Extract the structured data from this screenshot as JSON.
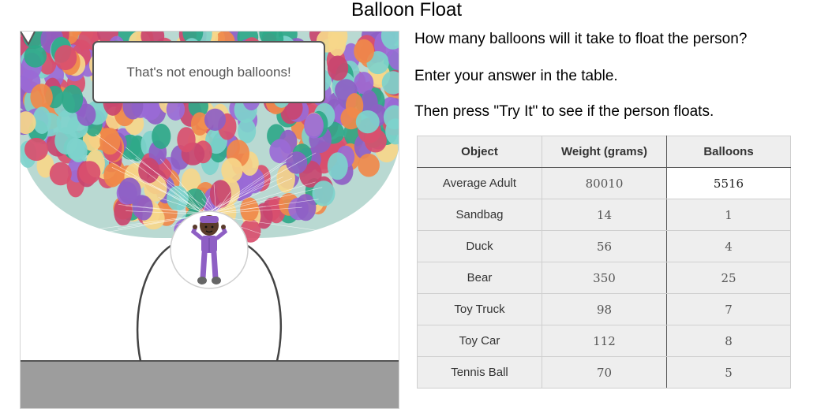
{
  "title": "Balloon Float",
  "speech_bubble": "That's not enough balloons!",
  "instructions": [
    "How many balloons will it take to float the person?",
    "Enter your answer in the table.",
    "Then press \"Try It\" to see if the person floats."
  ],
  "table": {
    "headers": [
      "Object",
      "Weight (grams)",
      "Balloons"
    ],
    "rows": [
      {
        "object": "Average Adult",
        "weight": "80010",
        "balloons": "5516"
      },
      {
        "object": "Sandbag",
        "weight": "14",
        "balloons": "1"
      },
      {
        "object": "Duck",
        "weight": "56",
        "balloons": "4"
      },
      {
        "object": "Bear",
        "weight": "350",
        "balloons": "25"
      },
      {
        "object": "Toy Truck",
        "weight": "98",
        "balloons": "7"
      },
      {
        "object": "Toy Car",
        "weight": "112",
        "balloons": "8"
      },
      {
        "object": "Tennis Ball",
        "weight": "70",
        "balloons": "5"
      }
    ]
  },
  "colors": {
    "balloons": [
      "#d94f6e",
      "#8e5fc4",
      "#2fa889",
      "#f0894a",
      "#7ed3cc",
      "#f6d78a",
      "#c9456f",
      "#9a6ad6"
    ],
    "ground": "#9d9d9d",
    "person_outfit": "#8e5fc4"
  },
  "icons": {
    "person": "person-figure-icon"
  }
}
